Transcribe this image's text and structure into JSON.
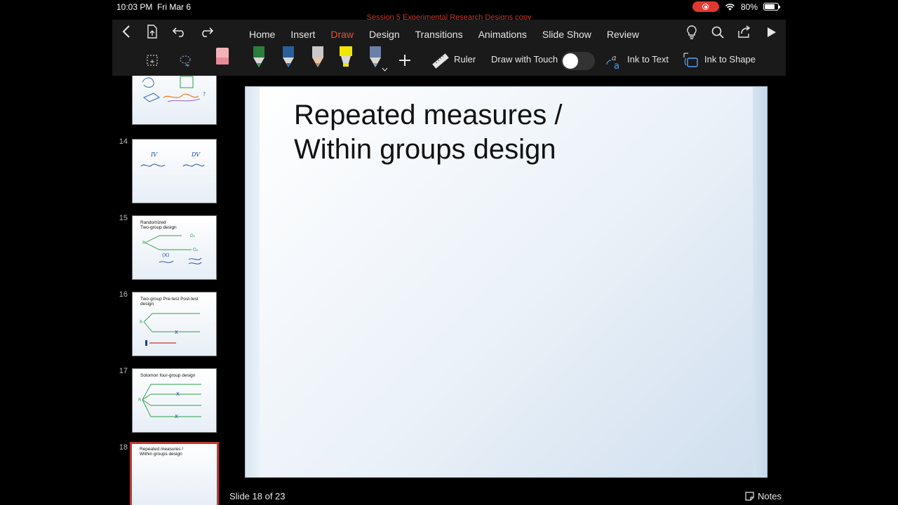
{
  "status": {
    "time": "10:03 PM",
    "date": "Fri Mar 6",
    "battery": "80%",
    "battery_level": 0.8
  },
  "document": {
    "title": "Session 5 Experimental Research Designs copy"
  },
  "tabs": [
    {
      "label": "Home",
      "active": false
    },
    {
      "label": "Insert",
      "active": false
    },
    {
      "label": "Draw",
      "active": true
    },
    {
      "label": "Design",
      "active": false
    },
    {
      "label": "Transitions",
      "active": false
    },
    {
      "label": "Animations",
      "active": false
    },
    {
      "label": "Slide Show",
      "active": false
    },
    {
      "label": "Review",
      "active": false
    }
  ],
  "draw_tools": {
    "pens": [
      {
        "name": "eraser",
        "color": "#e8a0a8"
      },
      {
        "name": "pen-green",
        "color": "#2e9e4a"
      },
      {
        "name": "pen-blue",
        "color": "#2f6fb5"
      },
      {
        "name": "pencil",
        "color": "#d9a07a"
      },
      {
        "name": "highlighter",
        "color": "#f2e600"
      },
      {
        "name": "galaxy-pen",
        "color": "#8aa2c8"
      }
    ],
    "ruler_label": "Ruler",
    "draw_with_touch_label": "Draw with Touch",
    "draw_with_touch_on": false,
    "ink_to_text_label": "Ink to Text",
    "ink_to_shape_label": "Ink to Shape"
  },
  "thumbnails": [
    {
      "number": "",
      "title": ""
    },
    {
      "number": "14",
      "title": ""
    },
    {
      "number": "15",
      "title": "Randomized\nTwo-group design"
    },
    {
      "number": "16",
      "title": "Two-group Pre-test Post-test\ndesign"
    },
    {
      "number": "17",
      "title": "Solomon four-group design"
    },
    {
      "number": "18",
      "title": "Repeated measures /\nWithin groups design"
    }
  ],
  "slide": {
    "title": "Repeated measures /\nWithin groups design"
  },
  "footer": {
    "slide_counter": "Slide 18 of 23",
    "notes_label": "Notes"
  }
}
